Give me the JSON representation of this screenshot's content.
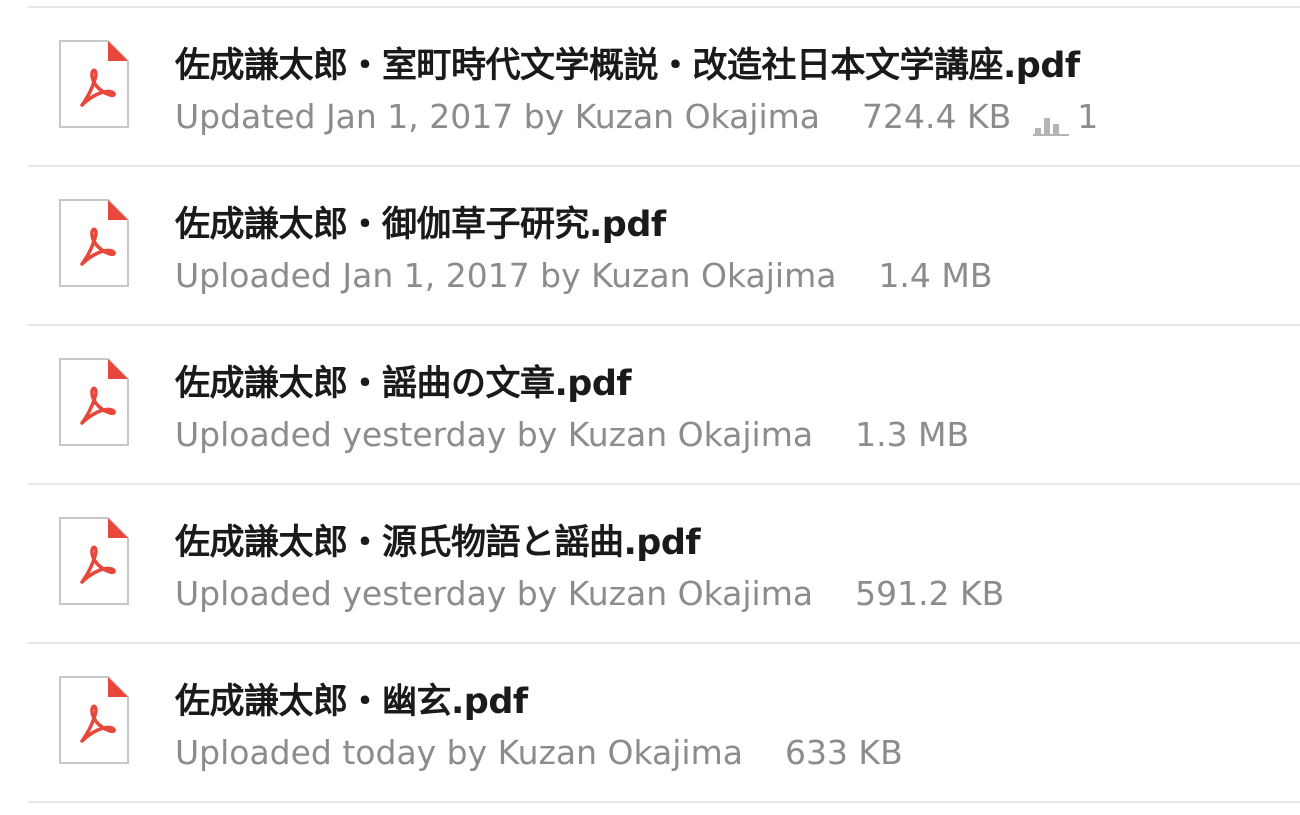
{
  "files": [
    {
      "name": "佐成謙太郎・室町時代文学概説・改造社日本文学講座.pdf",
      "meta": "Updated Jan 1, 2017 by Kuzan Okajima",
      "size": "724.4 KB",
      "views": "1",
      "icon": "pdf-file-icon"
    },
    {
      "name": "佐成謙太郎・御伽草子研究.pdf",
      "meta": "Uploaded Jan 1, 2017 by Kuzan Okajima",
      "size": "1.4 MB",
      "icon": "pdf-file-icon"
    },
    {
      "name": "佐成謙太郎・謡曲の文章.pdf",
      "meta": "Uploaded yesterday by Kuzan Okajima",
      "size": "1.3 MB",
      "icon": "pdf-file-icon"
    },
    {
      "name": "佐成謙太郎・源氏物語と謡曲.pdf",
      "meta": "Uploaded yesterday by Kuzan Okajima",
      "size": "591.2 KB",
      "icon": "pdf-file-icon"
    },
    {
      "name": "佐成謙太郎・幽玄.pdf",
      "meta": "Uploaded today by Kuzan Okajima",
      "size": "633 KB",
      "icon": "pdf-file-icon"
    }
  ],
  "colors": {
    "pdf_accent": "#e8473b",
    "meta_text": "#8c8c8c",
    "divider": "#e6e6e6"
  }
}
